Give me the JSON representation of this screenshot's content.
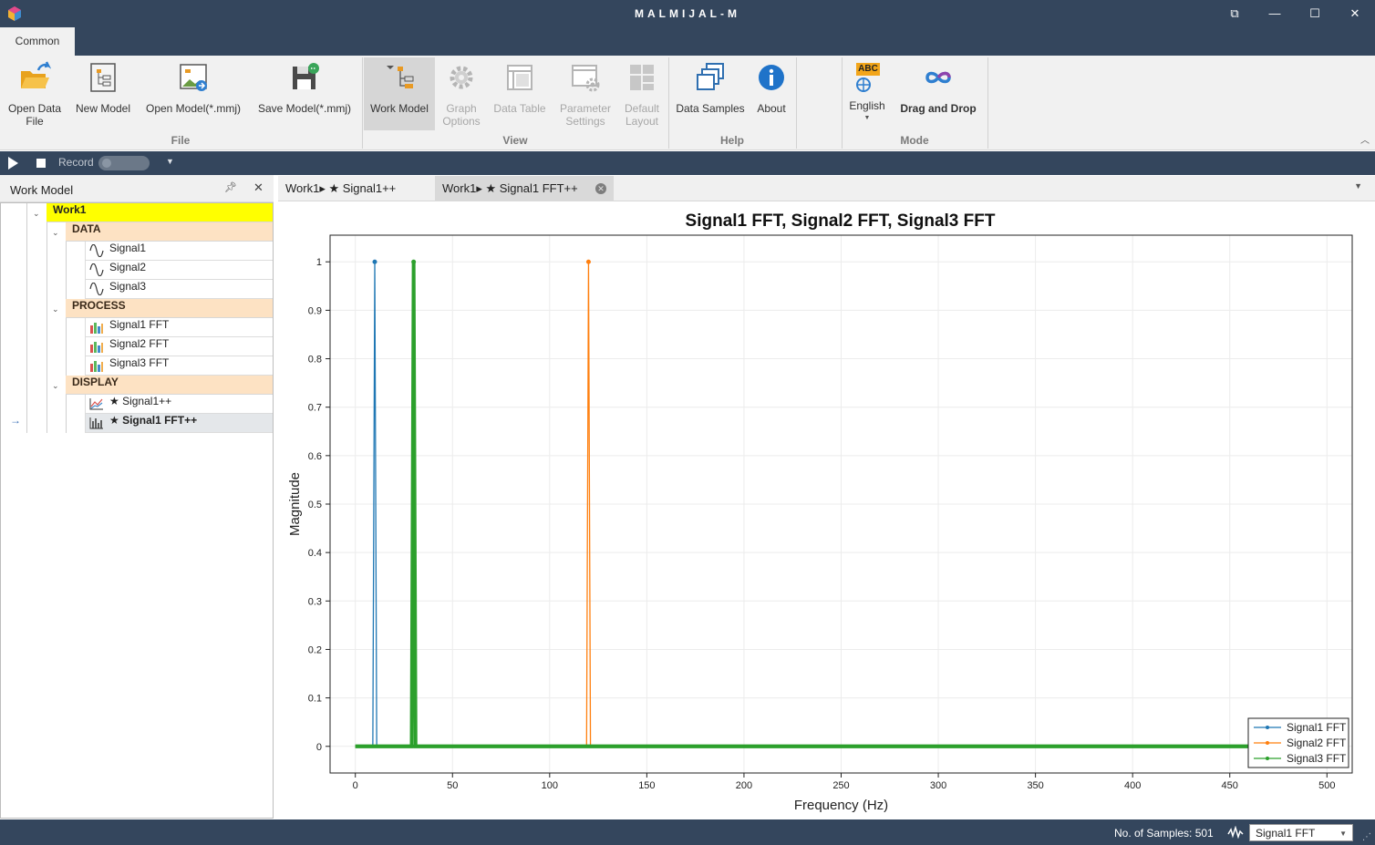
{
  "window": {
    "title": "MALMIJAL-M",
    "controls": [
      "⧉",
      "—",
      "☐",
      "✕"
    ]
  },
  "ribbon": {
    "tab": "Common",
    "groups": {
      "file": "File",
      "view": "View",
      "help": "Help",
      "mode": "Mode"
    },
    "buttons": {
      "open_data_file": "Open Data\nFile",
      "new_model": "New Model",
      "open_model": "Open Model(*.mmj)",
      "save_model": "Save Model(*.mmj)",
      "work_model": "Work Model",
      "graph_options": "Graph\nOptions",
      "data_table": "Data Table",
      "parameter_settings": "Parameter\nSettings",
      "default_layout": "Default\nLayout",
      "data_samples": "Data Samples",
      "about": "About",
      "english": "English",
      "drag_and_drop": "Drag and Drop"
    },
    "abc_badge": "ABC"
  },
  "recordbar": {
    "label": "Record"
  },
  "panel": {
    "title": "Work Model",
    "root": "Work1",
    "categories": [
      "DATA",
      "PROCESS",
      "DISPLAY"
    ],
    "data_items": [
      "Signal1",
      "Signal2",
      "Signal3"
    ],
    "process_items": [
      "Signal1 FFT",
      "Signal2 FFT",
      "Signal3 FFT"
    ],
    "display_items": [
      "★ Signal1++",
      "★ Signal1 FFT++"
    ]
  },
  "doc_tabs": [
    "Work1▸ ★ Signal1++",
    "Work1▸ ★ Signal1 FFT++"
  ],
  "chart_data": {
    "type": "line",
    "title": "Signal1 FFT, Signal2 FFT, Signal3 FFT",
    "xlabel": "Frequency (Hz)",
    "ylabel": "Magnitude",
    "xlim": [
      -13,
      513
    ],
    "ylim": [
      -0.055,
      1.055
    ],
    "xticks": [
      0,
      50,
      100,
      150,
      200,
      250,
      300,
      350,
      400,
      450,
      500
    ],
    "yticks": [
      0,
      0.1,
      0.2,
      0.3,
      0.4,
      0.5,
      0.6,
      0.7,
      0.8,
      0.9,
      1
    ],
    "grid": true,
    "legend_position": "bottom-right",
    "samples": 501,
    "series": [
      {
        "name": "Signal1 FFT",
        "color": "#1f77b4",
        "peaks": [
          {
            "x": 10,
            "y": 1
          }
        ]
      },
      {
        "name": "Signal2 FFT",
        "color": "#ff7f0e",
        "peaks": [
          {
            "x": 120,
            "y": 1
          }
        ]
      },
      {
        "name": "Signal3 FFT",
        "color": "#2ca02c",
        "peaks": [
          {
            "x": 30,
            "y": 1
          }
        ]
      }
    ]
  },
  "status": {
    "samples_text": "No. of Samples: 501",
    "selected_series": "Signal1 FFT"
  },
  "colors": {
    "titlebar": "#34465d",
    "ribbon": "#f1f1f1",
    "root_highlight": "#ffff00",
    "category_bg": "#fde2c3"
  }
}
